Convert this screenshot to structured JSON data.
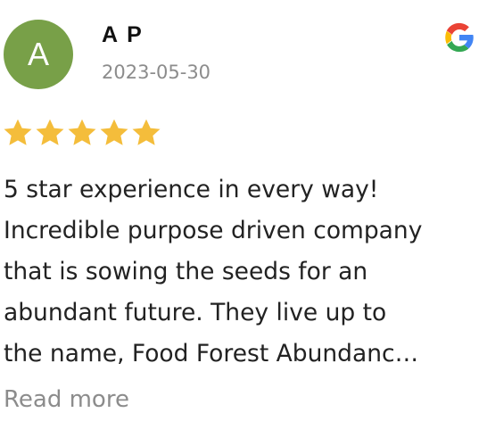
{
  "review": {
    "avatar_initial": "A",
    "reviewer_name": "A P",
    "date": "2023-05-30",
    "source_icon": "google-g-icon",
    "rating": 5,
    "rating_max": 5,
    "text_lines": [
      "5 star experience in every way!",
      "Incredible purpose driven company",
      "that is sowing the seeds for an",
      "abundant future. They live up to",
      "the name, Food Forest Abundanc…"
    ],
    "read_more_label": "Read more"
  },
  "colors": {
    "avatar_bg": "#78a048",
    "star": "#f4bd3b",
    "muted_text": "#8c8c8c",
    "google_blue": "#4285F4",
    "google_red": "#EA4335",
    "google_yellow": "#FBBC05",
    "google_green": "#34A853"
  }
}
